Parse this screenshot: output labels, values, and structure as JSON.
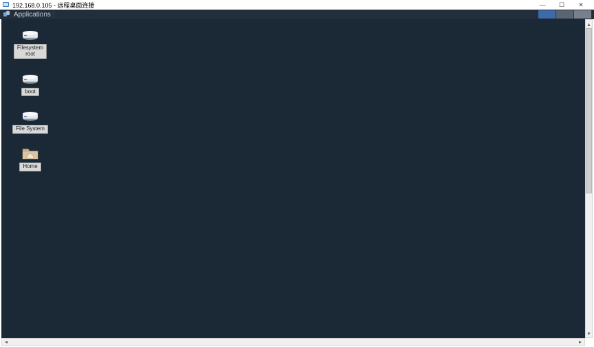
{
  "window": {
    "title": "192.168.0.105 - 远程桌面连接",
    "controls": {
      "min": "—",
      "max": "☐",
      "close": "✕"
    }
  },
  "panel": {
    "applications_label": "Applications"
  },
  "desktop": {
    "icons": [
      {
        "kind": "drive",
        "label": "Filesystem\nroot"
      },
      {
        "kind": "drive",
        "label": "boot"
      },
      {
        "kind": "drive",
        "label": "File System"
      },
      {
        "kind": "folder",
        "label": "Home"
      }
    ]
  }
}
